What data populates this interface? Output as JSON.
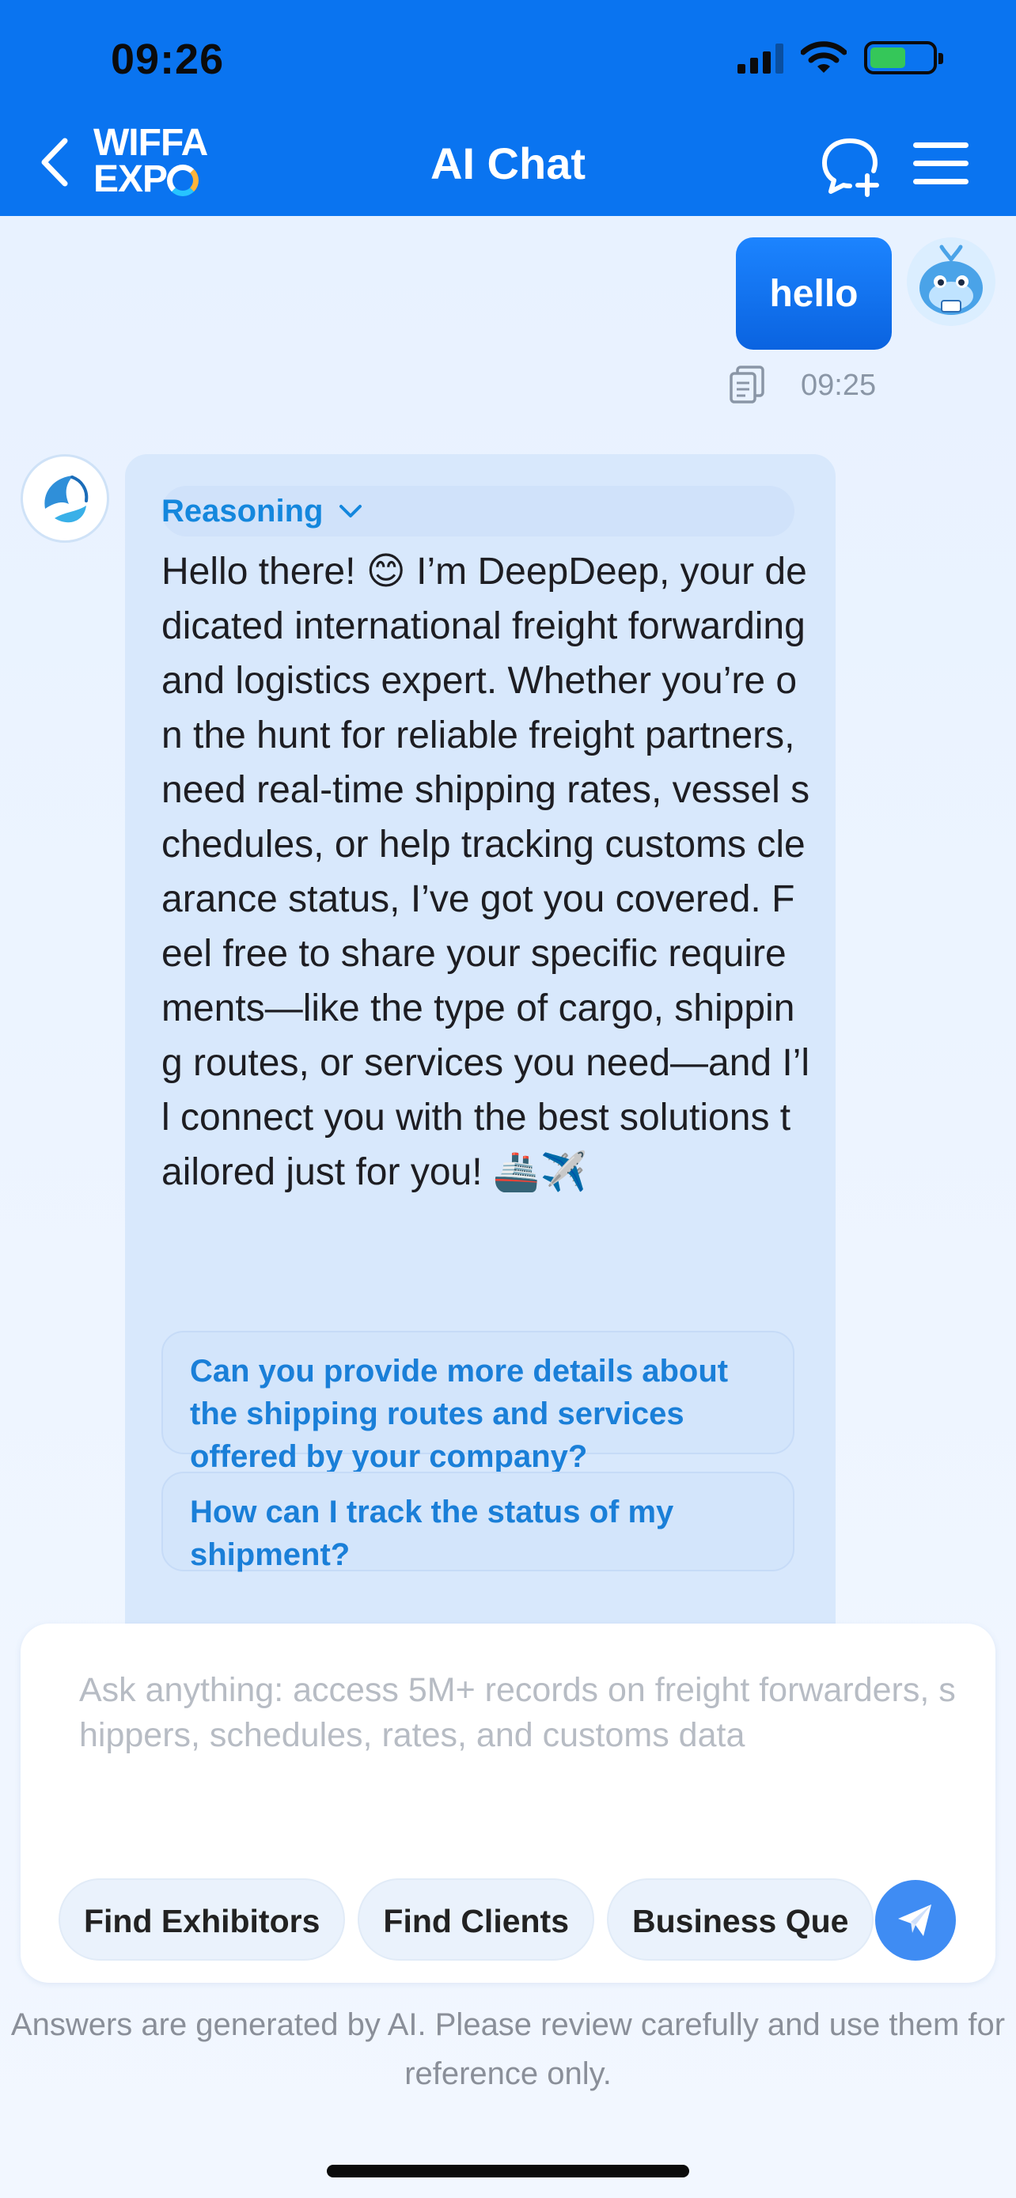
{
  "status_bar": {
    "time": "09:26"
  },
  "header": {
    "logo_line1": "WIFFA",
    "logo_line2": "EXP",
    "title": "AI Chat",
    "back_icon": "chevron-left-icon",
    "new_chat_icon": "chat-plus-icon",
    "menu_icon": "hamburger-menu-icon"
  },
  "user_message": {
    "text": "hello",
    "time": "09:25"
  },
  "bot_message": {
    "reasoning_label": "Reasoning",
    "text_before_emoji": "Hello there! ",
    "emoji_smile": "😊",
    "text_main": " I’m DeepDeep, your dedicated international freight forwarding and logistics expert. Whether you’re on the hunt for reliable freight partners, need real-time shipping rates, vessel schedules, or help tracking customs clearance status, I’ve got you covered. Feel free to share your specific requirements—like the type of cargo, shipping routes, or services you need—and I’ll connect you with the best solutions tailored just for you! ",
    "emoji_end": "🚢✈️",
    "suggestions": [
      "Can you provide more details about the shipping routes and services offered by your company?",
      "How can I track the status of my shipment?"
    ]
  },
  "input": {
    "placeholder": "Ask anything: access 5M+ records on freight forwarders, shippers, schedules, rates, and customs data",
    "chips": [
      "Find Exhibitors",
      "Find Clients",
      "Business Que"
    ],
    "send_icon": "paper-plane-icon"
  },
  "disclaimer": "Answers are generated by AI. Please review carefully and use them for reference only.",
  "colors": {
    "header": "#0a74f0",
    "accent": "#1487dd",
    "bubble": "#0a63e0"
  }
}
